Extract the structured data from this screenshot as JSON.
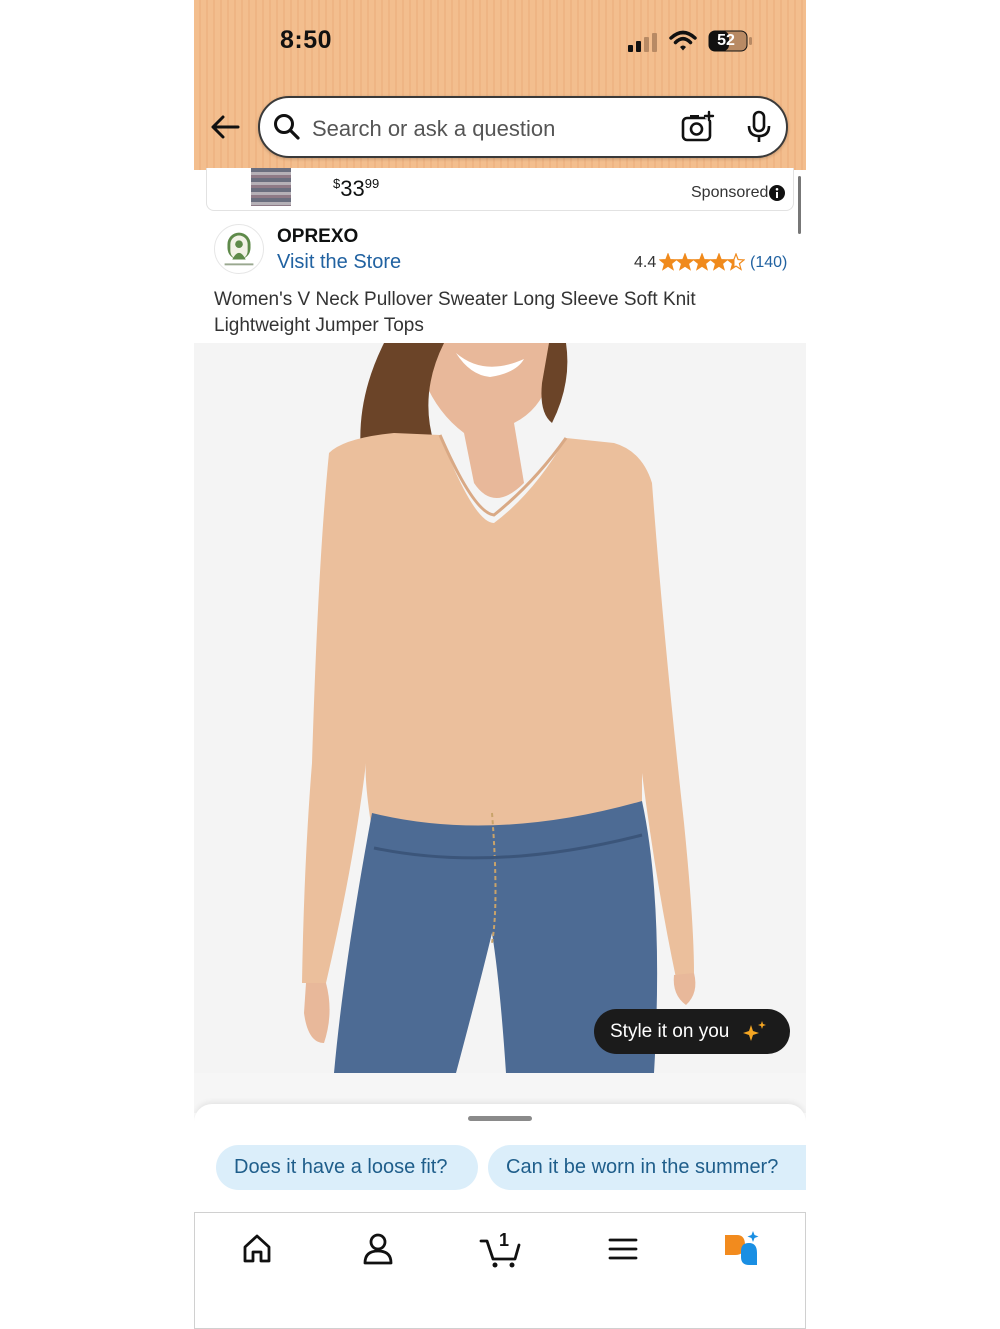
{
  "status_bar": {
    "time": "8:50",
    "battery": "52",
    "icons": [
      "signal-icon",
      "wifi-icon",
      "battery-icon"
    ]
  },
  "header": {
    "back_icon": "back-arrow-icon",
    "search": {
      "placeholder": "Search or ask a question",
      "icons": [
        "search-icon",
        "camera-icon",
        "mic-icon"
      ]
    },
    "colors": {
      "background": "#f3be8e"
    }
  },
  "sponsored": {
    "price": "$33",
    "price_symbol": "$",
    "price_whole": "33",
    "price_fraction": "99",
    "label": "Sponsored"
  },
  "store": {
    "name": "OPREXO",
    "link": "Visit the Store",
    "rating": "4.4",
    "rating_stars": 4.4,
    "review_count": "(140)"
  },
  "product": {
    "title": "Women's V Neck Pullover Sweater Long Sleeve Soft Knit Lightweight Jumper Tops",
    "style_button": "Style it on you"
  },
  "suggestions": [
    {
      "label": "Does it have a loose fit?"
    },
    {
      "label": "Can it be worn in the summer?"
    }
  ],
  "nav": {
    "items": [
      "home-icon",
      "account-icon",
      "cart-icon",
      "menu-icon",
      "rufus-icon"
    ],
    "cart_count": "1",
    "colors": {
      "rufus_orange": "#f28b1e",
      "rufus_blue": "#1a8fe3"
    }
  },
  "colors": {
    "link": "#2162a1",
    "star": "#f08a1c",
    "chip_bg": "#dbeefa"
  }
}
